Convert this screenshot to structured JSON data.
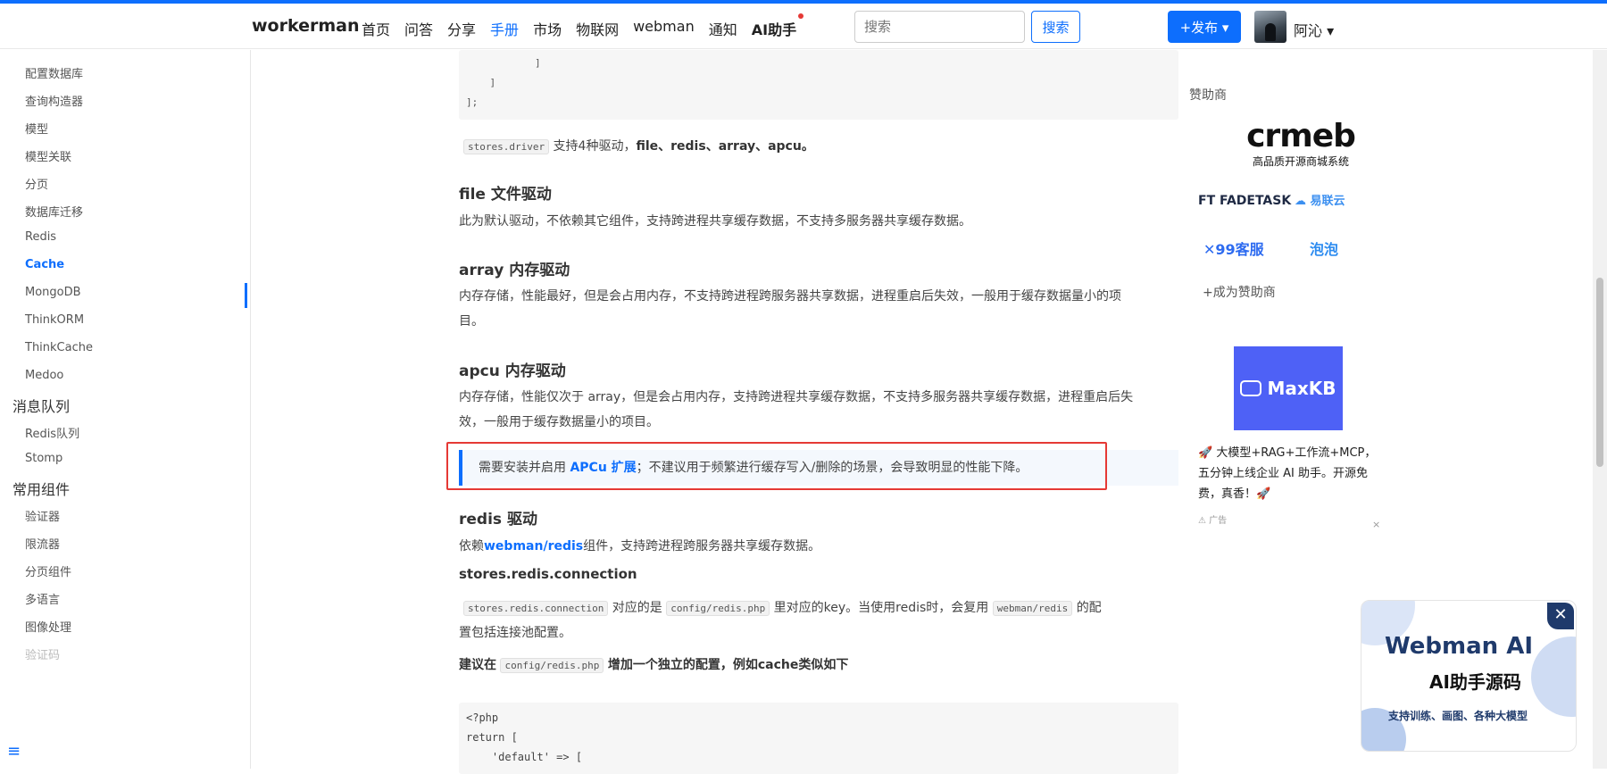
{
  "header": {
    "brand": "workerman",
    "nav": [
      {
        "label": "首页"
      },
      {
        "label": "问答"
      },
      {
        "label": "分享"
      },
      {
        "label": "手册"
      },
      {
        "label": "市场"
      },
      {
        "label": "物联网"
      },
      {
        "label": "webman"
      },
      {
        "label": "通知"
      },
      {
        "label": "AI助手"
      }
    ],
    "active_nav": "手册",
    "search_placeholder": "搜索",
    "search_button": "搜索",
    "publish_button": "+发布 ▾",
    "username": "阿沁 ▾",
    "accent_color": "#0d6efd"
  },
  "sidebar": {
    "items_top": [
      "配置数据库",
      "查询构造器",
      "模型",
      "模型关联",
      "分页",
      "数据库迁移",
      "Redis",
      "Cache",
      "MongoDB",
      "ThinkORM",
      "ThinkCache",
      "Medoo"
    ],
    "active_item": "Cache",
    "group_mq": "消息队列",
    "items_mq": [
      "Redis队列",
      "Stomp"
    ],
    "group_common": "常用组件",
    "items_common": [
      "验证器",
      "限流器",
      "分页组件",
      "多语言",
      "图像处理",
      "验证码"
    ],
    "menu_icon": "≡"
  },
  "main": {
    "code_top": [
      "        ]",
      "    ]",
      "];"
    ],
    "drivers_code": "stores.driver",
    "drivers_text": "支持4种驱动，",
    "drivers_list": "file、redis、array、apcu。",
    "h_file": "file 文件驱动",
    "p_file": "此为默认驱动，不依赖其它组件，支持跨进程共享缓存数据，不支持多服务器共享缓存数据。",
    "h_array": "array 内存驱动",
    "p_array_1": "内存存储，性能最好，但是会占用内存，不支持跨进程跨服务器共享数据，进程重启后失效，一般用于缓存数据量小的项",
    "p_array_2": "目。",
    "h_apcu": "apcu 内存驱动",
    "p_apcu_1": "内存存储，性能仅次于 array，但是会占用内存，支持跨进程共享缓存数据，不支持多服务器共享缓存数据，进程重启后失",
    "p_apcu_2": "效，一般用于缓存数据量小的项目。",
    "tip_pre": "需要安装并启用",
    "tip_link": "APCu 扩展",
    "tip_post": "；不建议用于频繁进行缓存写入/删除的场景，会导致明显的性能下降。",
    "h_redis": "redis 驱动",
    "p_redis_pre": "依赖",
    "p_redis_link": "webman/redis",
    "p_redis_post": "组件，支持跨进程跨服务器共享缓存数据。",
    "h_conn": "stores.redis.connection",
    "conn_code1": "stores.redis.connection",
    "conn_t1": "对应的是",
    "conn_code2": "config/redis.php",
    "conn_t2": "里对应的key。当使用redis时，会复用",
    "conn_code3": "webman/redis",
    "conn_t3": "的配",
    "conn_line2": "置包括连接池配置。",
    "suggest_pre": "建议在",
    "suggest_code": "config/redis.php",
    "suggest_post": "增加一个独立的配置，例如cache类似如下",
    "code_bottom": [
      "<?php",
      "return [",
      "    'default' => ["
    ]
  },
  "right": {
    "sponsor_title": "赞助商",
    "crmeb_logo": "crmeb",
    "crmeb_sub": "高品质开源商城系统",
    "sp_fadetask": "FT FADETASK",
    "sp_yilianyun": "易联云",
    "sp_99": "✕99客服",
    "sp_paopao": "泡泡",
    "become_sponsor": "+成为赞助商",
    "maxkb": "MaxKB",
    "ad_text": "🚀 大模型+RAG+工作流+MCP，五分钟上线企业 AI 助手。开源免费，真香！🚀",
    "ad_label": "广告",
    "ad_close": "×"
  },
  "promo": {
    "title": "Webman AI",
    "subtitle": "AI助手源码",
    "caption": "支持训练、画图、各种大模型",
    "close": "✕"
  }
}
